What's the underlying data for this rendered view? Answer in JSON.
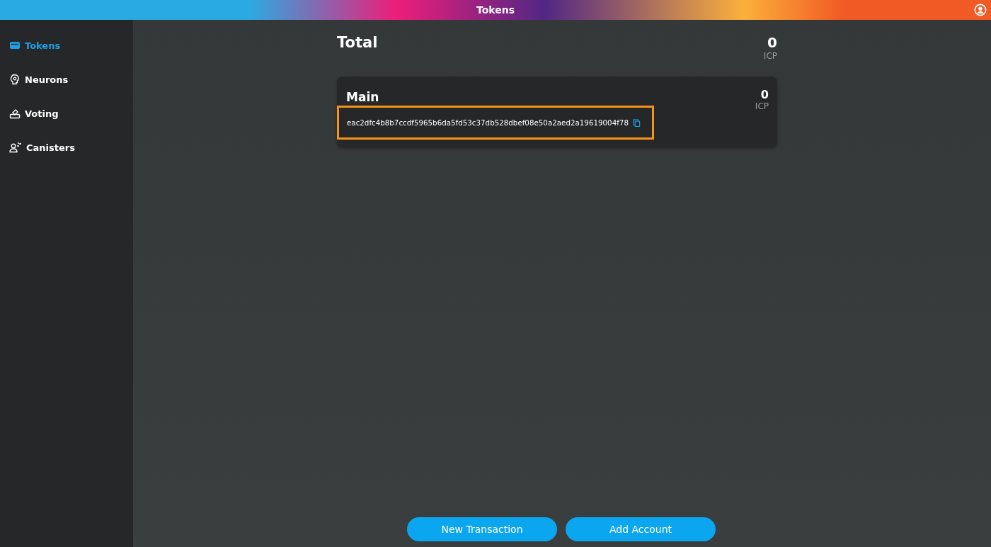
{
  "header": {
    "title": "Tokens"
  },
  "sidebar": {
    "items": [
      {
        "label": "Tokens",
        "selected": true
      },
      {
        "label": "Neurons",
        "selected": false
      },
      {
        "label": "Voting",
        "selected": false
      },
      {
        "label": "Canisters",
        "selected": false
      }
    ]
  },
  "total": {
    "label": "Total",
    "amount": "0",
    "unit": "ICP"
  },
  "accounts": [
    {
      "name": "Main",
      "amount": "0",
      "unit": "ICP",
      "identifier": "eac2dfc4b8b7ccdf5965b6da5fd53c37db528dbef08e50a2aed2a19619004f78",
      "highlighted": true
    }
  ],
  "buttons": [
    "New Transaction",
    "Add Account"
  ]
}
